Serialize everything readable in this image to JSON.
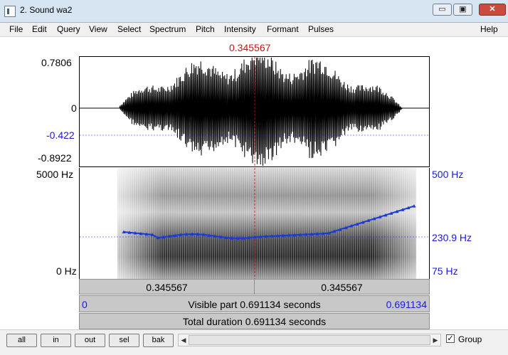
{
  "window": {
    "title": "2. Sound wa2",
    "buttons": {
      "minimize": "▭",
      "maximize": "▣",
      "close": "✕"
    }
  },
  "menu": [
    "File",
    "Edit",
    "Query",
    "View",
    "Select",
    "Spectrum",
    "Pitch",
    "Intensity",
    "Formant",
    "Pulses"
  ],
  "help": "Help",
  "cursor": {
    "time": "0.345567"
  },
  "waveform": {
    "y_max": "0.7806",
    "y_zero": "0",
    "y_cursor": "-0.422",
    "y_min": "-0.8922"
  },
  "spectrogram": {
    "freq_top": "5000 Hz",
    "freq_bottom": "0 Hz",
    "pitch_top": "500 Hz",
    "pitch_cursor": "230.9 Hz",
    "pitch_bottom": "75 Hz"
  },
  "timebars": {
    "left_value": "0.345567",
    "right_value": "0.345567",
    "visible_start": "0",
    "visible_label": "Visible part 0.691134 seconds",
    "visible_end": "0.691134",
    "total_label": "Total duration 0.691134 seconds"
  },
  "toolbar": {
    "buttons": [
      "all",
      "in",
      "out",
      "sel",
      "bak"
    ],
    "scroll_left": "◀",
    "scroll_right": "▶",
    "group_label": "Group",
    "group_checked": "✓"
  },
  "colors": {
    "cursor": "#d21010",
    "pitch": "#1a3ad8",
    "labels_blue": "#1a1ad8"
  }
}
